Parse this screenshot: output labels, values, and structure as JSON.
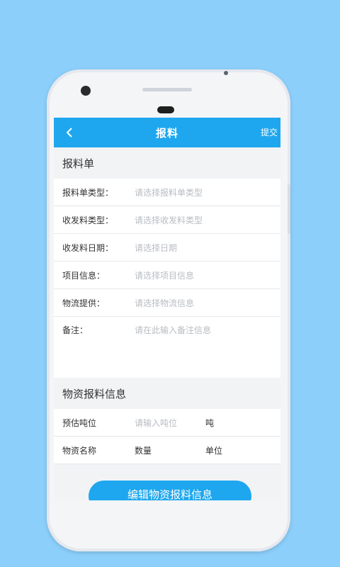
{
  "appbar": {
    "title": "报料",
    "submit_label": "提交",
    "background_color": "#1ea7ee"
  },
  "form_section": {
    "title": "报料单",
    "rows": [
      {
        "label": "报料单类型：",
        "placeholder": "请选择报料单类型"
      },
      {
        "label": "收发料类型：",
        "placeholder": "请选择收发料类型"
      },
      {
        "label": "收发料日期：",
        "placeholder": "请选择日期"
      },
      {
        "label": "项目信息：",
        "placeholder": "请选择项目信息"
      },
      {
        "label": "物流提供：",
        "placeholder": "请选择物流信息"
      },
      {
        "label": "备注：",
        "placeholder": "请在此输入备注信息"
      }
    ]
  },
  "material_section": {
    "title": "物资报料信息",
    "tonnage": {
      "label": "预估吨位",
      "placeholder": "请输入吨位",
      "unit": "吨"
    },
    "header": {
      "name": "物资名称",
      "quantity": "数量",
      "unit": "单位"
    }
  },
  "action_button": {
    "label": "编辑物资报料信息"
  },
  "icons": {
    "back": "back-arrow-icon"
  }
}
